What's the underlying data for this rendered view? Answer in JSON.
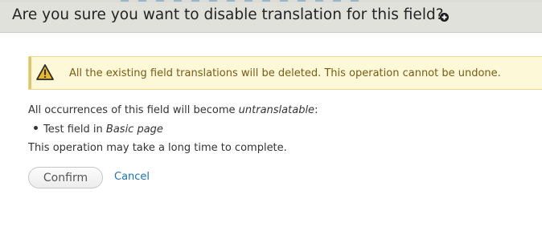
{
  "dialog": {
    "title": "Are you sure you want to disable translation for this field?",
    "close_icon": "close-icon"
  },
  "warning": {
    "icon": "warning-icon",
    "message": "All the existing field translations will be deleted. This operation cannot be undone."
  },
  "body": {
    "occurrences_prefix": "All occurrences of this field will become ",
    "occurrences_emphasis": "untranslatable",
    "occurrences_suffix": ":",
    "list_item_text": "Test field in ",
    "list_item_emphasis": "Basic page",
    "time_note": "This operation may take a long time to complete."
  },
  "actions": {
    "confirm_label": "Confirm",
    "cancel_label": "Cancel"
  },
  "colors": {
    "header_bg": "#e1e1dc",
    "warning_bg": "#fdf8d8",
    "warning_text": "#7a5b13",
    "link": "#1a73b8"
  }
}
